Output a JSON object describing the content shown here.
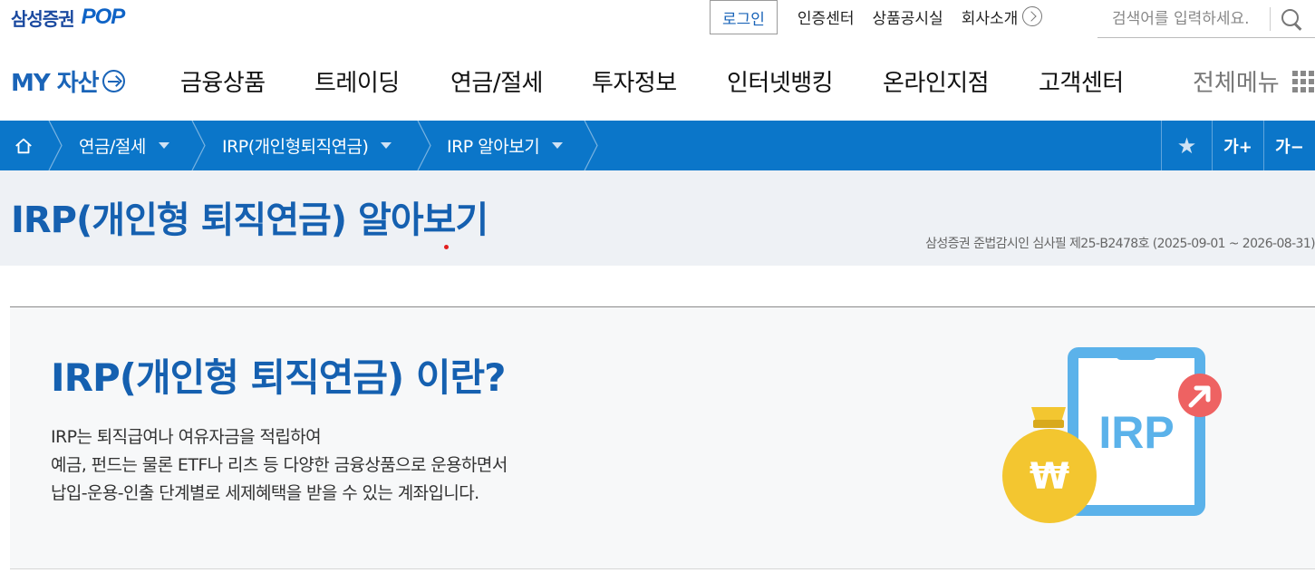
{
  "brand": {
    "company": "삼성증권",
    "product": "POP"
  },
  "utility": {
    "login": "로그인",
    "links": [
      "인증센터",
      "상품공시실",
      "회사소개"
    ],
    "search_placeholder": "검색어를 입력하세요."
  },
  "nav": {
    "my_asset": "MY 자산",
    "items": [
      "금융상품",
      "트레이딩",
      "연금/절세",
      "투자정보",
      "인터넷뱅킹",
      "온라인지점",
      "고객센터"
    ],
    "all_menu": "전체메뉴"
  },
  "breadcrumb": {
    "items": [
      "연금/절세",
      "IRP(개인형퇴직연금)",
      "IRP 알아보기"
    ],
    "tools": {
      "star": "★",
      "font_up": "가+",
      "font_down": "가−"
    }
  },
  "page": {
    "title": "IRP(개인형 퇴직연금) 알아보기",
    "review_notice": "삼성증권 준법감시인 심사필 제25-B2478호 (2025-09-01 ~ 2026-08-31)"
  },
  "intro": {
    "title": "IRP(개인형 퇴직연금) 이란?",
    "lines": [
      "IRP는 퇴직급여나 여유자금을 적립하여",
      "예금, 펀드는 물론 ETF나 리츠 등 다양한 금융상품으로 운용하면서",
      "납입-운용-인출 단계별로 세제혜택을 받을 수 있는 계좌입니다."
    ],
    "illustration": {
      "board_label": "IRP",
      "coin_symbol": "₩"
    }
  },
  "colors": {
    "brand_blue": "#1560b0",
    "crumb_bar": "#0b76c9",
    "title_band": "#eef1f5",
    "intro_bg": "#f7f8f9"
  }
}
